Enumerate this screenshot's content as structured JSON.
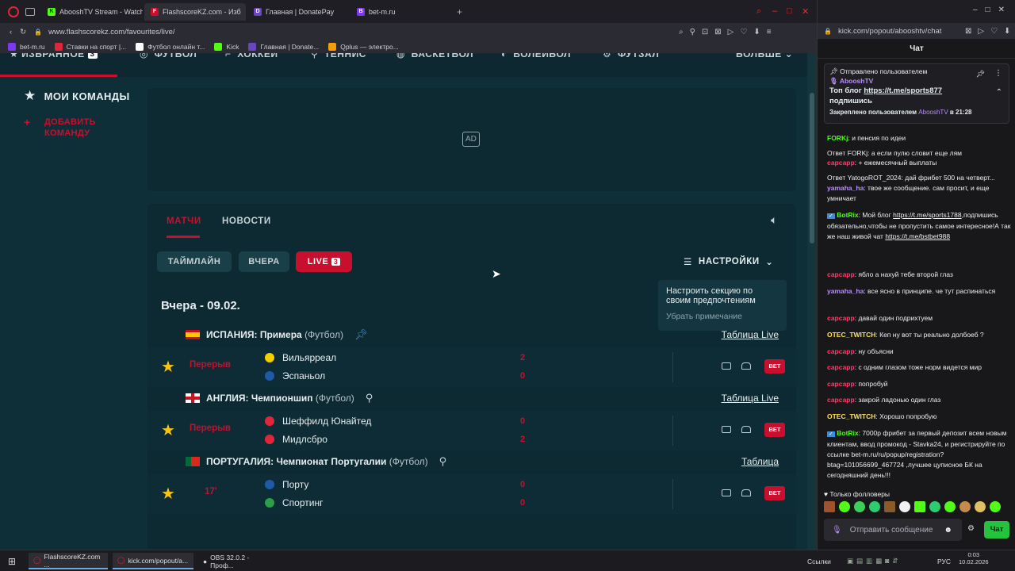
{
  "browser": {
    "tabs": [
      {
        "label": "AbooshTV Stream - Watch",
        "icon": "kick-icon",
        "color": "#53fc18"
      },
      {
        "label": "FlashscoreKZ.com - Изб",
        "icon": "flashscore-icon",
        "color": "#c8102e",
        "active": true
      },
      {
        "label": "Главная | DonatePay",
        "icon": "donatepay-icon",
        "color": "#6b46c1"
      },
      {
        "label": "bet-m.ru",
        "icon": "betm-icon",
        "color": "#7c3aed"
      }
    ],
    "url": "www.flashscorekz.com/favourites/live/",
    "bookmarks": [
      {
        "label": "bet-m.ru",
        "color": "#7c3aed"
      },
      {
        "label": "Ставки на спорт |...",
        "color": "#e0263b"
      },
      {
        "label": "Футбол онлайн т...",
        "color": "#ffffff"
      },
      {
        "label": "Kick",
        "color": "#53fc18"
      },
      {
        "label": "Главная | Donate...",
        "color": "#6b46c1"
      },
      {
        "label": "Qplus — электро...",
        "color": "#f59e0b"
      }
    ]
  },
  "nav": {
    "items": [
      "ИЗБРАННОЕ",
      "ФУТБОЛ",
      "ХОККЕЙ",
      "ТЕННИС",
      "БАСКЕТБОЛ",
      "ВОЛЕЙБОЛ",
      "ФУТЗАЛ",
      "БОЛЬШЕ"
    ],
    "favourites_count": "3"
  },
  "sidebar": {
    "my_teams": "МОИ КОМАНДЫ",
    "add_team": [
      "ДОБАВИТЬ",
      "КОМАНДУ"
    ]
  },
  "ad": {
    "label": "AD"
  },
  "main": {
    "tabs": [
      "МАТЧИ",
      "НОВОСТИ"
    ],
    "filters": {
      "timeline": "ТАЙМЛАЙН",
      "yesterday": "ВЧЕРА",
      "live": "LIVE",
      "live_count": "3"
    },
    "settings": "НАСТРОЙКИ",
    "popup": {
      "title": "Настроить секцию по своим предпочтениям",
      "dismiss": "Убрать примечание"
    },
    "date": "Вчера - 09.02.",
    "leagues": [
      {
        "name": "ИСПАНИЯ: Примера",
        "sport": "(Футбол)",
        "flag": "spain",
        "link": "Таблица Live",
        "pinned": true,
        "match": {
          "status": "Перерыв",
          "home": "Вильярреал",
          "away": "Эспаньол",
          "home_score": "2",
          "away_score": "0",
          "home_color": "#f5d000",
          "away_color": "#1e5aa8"
        }
      },
      {
        "name": "АНГЛИЯ: Чемпионшип",
        "sport": "(Футбол)",
        "flag": "england",
        "link": "Таблица Live",
        "pinned": false,
        "match": {
          "status": "Перерыв",
          "home": "Шеффилд Юнайтед",
          "away": "Мидлсбро",
          "home_score": "0",
          "away_score": "2",
          "home_color": "#e0263b",
          "away_color": "#e0263b"
        }
      },
      {
        "name": "ПОРТУГАЛИЯ: Чемпионат Португалии",
        "sport": "(Футбол)",
        "flag": "portugal",
        "link": "Таблица",
        "pinned": false,
        "match": {
          "status": "17'",
          "home": "Порту",
          "away": "Спортинг",
          "home_score": "0",
          "away_score": "0",
          "home_color": "#1e5aa8",
          "away_color": "#2e9d48"
        }
      }
    ],
    "bet_label": "BET"
  },
  "chat": {
    "url": "kick.com/popout/abooshtv/chat",
    "header": "Чат",
    "pinned": {
      "title": "Отправлено пользователем",
      "user": "AbooshTV",
      "text_prefix": "Топ блог",
      "link": "https://t.me/sports877",
      "text_suffix": "подпишись",
      "footer_prefix": "Закреплено пользователем",
      "footer_user": "AbooshTV",
      "footer_time": "в 21:28"
    },
    "messages": [
      {
        "user": "FORKj",
        "color": "#53fc18",
        "text": "и пенсия по идеи"
      },
      {
        "reply": "Ответ FORKj: а если пулю словит еще лям"
      },
      {
        "user": "сарсарр",
        "color": "#ff3b6b",
        "text": "+ ежемесячный выплаты"
      },
      {
        "reply": "Ответ YatogoROT_2024: дай фрибет 500 на четверт..."
      },
      {
        "user": "yamaha_ha",
        "color": "#b98cff",
        "text": "твое же сообщение. сам просит, и еще умничает"
      },
      {
        "user": "BotRix",
        "color": "#53fc18",
        "text": "Мой блог",
        "link": "https://t.me/sports1788",
        "text2": ",подпишись обязательно,чтобы не пропустить самое интересное!А так же наш живой чат",
        "link2": "https://t.me/bstbet988"
      },
      {
        "user": "сарсарр",
        "color": "#ff3b6b",
        "text": "ябло а нахуй тебе второй глаз"
      },
      {
        "user": "yamaha_ha",
        "color": "#b98cff",
        "text": "все ясно в принципе. че тут распинаться"
      },
      {
        "user": "сарсарр",
        "color": "#ff3b6b",
        "text": "давай один подрихтуем"
      },
      {
        "user": "OTEC_TWITCH",
        "color": "#ffe14d",
        "text": "Кеп ну вот ты реально долбоеб ?"
      },
      {
        "user": "сарсарр",
        "color": "#ff3b6b",
        "text": "ну объясни"
      },
      {
        "user": "сарсарр",
        "color": "#ff3b6b",
        "text": "с одним глазом тоже норм видется мир"
      },
      {
        "user": "сарсарр",
        "color": "#ff3b6b",
        "text": "попробуй"
      },
      {
        "user": "сарсарр",
        "color": "#ff3b6b",
        "text": "закрой ладонью один глаз"
      },
      {
        "user": "OTEC_TWITCH",
        "color": "#ffe14d",
        "text": "Хорошо попробую"
      },
      {
        "user": "BotRix",
        "color": "#53fc18",
        "text": "7000р фрибет за первый депозит всем новым клиентам, ввод промокод - Stavka24, и регистрируйте по ссылке bet-m.ru/ru/popup/registration?btag=101056699_467724 ,лучшее цуписное БК на сегодняшний день!!!"
      }
    ],
    "followers_only": "Только фолловеры",
    "input_placeholder": "Отправить сообщение",
    "send_label": "Чат"
  },
  "taskbar": {
    "items": [
      "FlashscoreKZ.com ...",
      "kick.com/popout/a...",
      "OBS 32.0.2 - Проф..."
    ],
    "links": "Ссылки",
    "lang": "РУС",
    "time": "0:03",
    "date": "10.02.2026"
  }
}
